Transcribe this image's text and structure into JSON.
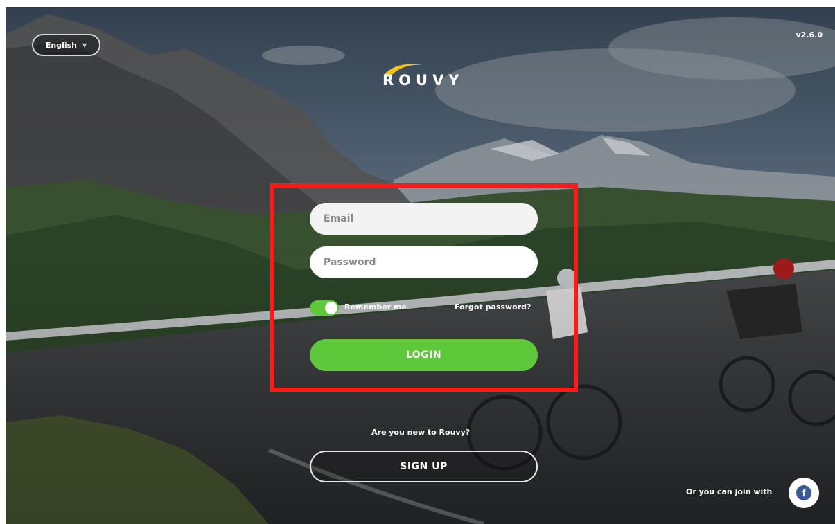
{
  "header": {
    "language_label": "English",
    "version": "v2.6.0",
    "logo_text": "ROUVY"
  },
  "login_form": {
    "email_placeholder": "Email",
    "password_placeholder": "Password",
    "remember_label": "Remember me",
    "remember_on": true,
    "forgot_label": "Forgot password?",
    "login_label": "LOGIN"
  },
  "signup": {
    "prompt": "Are you new to Rouvy?",
    "button_label": "SIGN UP"
  },
  "social": {
    "join_text": "Or you can join with",
    "facebook_icon": "facebook-icon"
  },
  "colors": {
    "accent_green": "#5cc83a",
    "highlight_red": "#ff1a1a",
    "logo_yellow": "#f2c21a",
    "facebook_blue": "#3b5b98"
  }
}
